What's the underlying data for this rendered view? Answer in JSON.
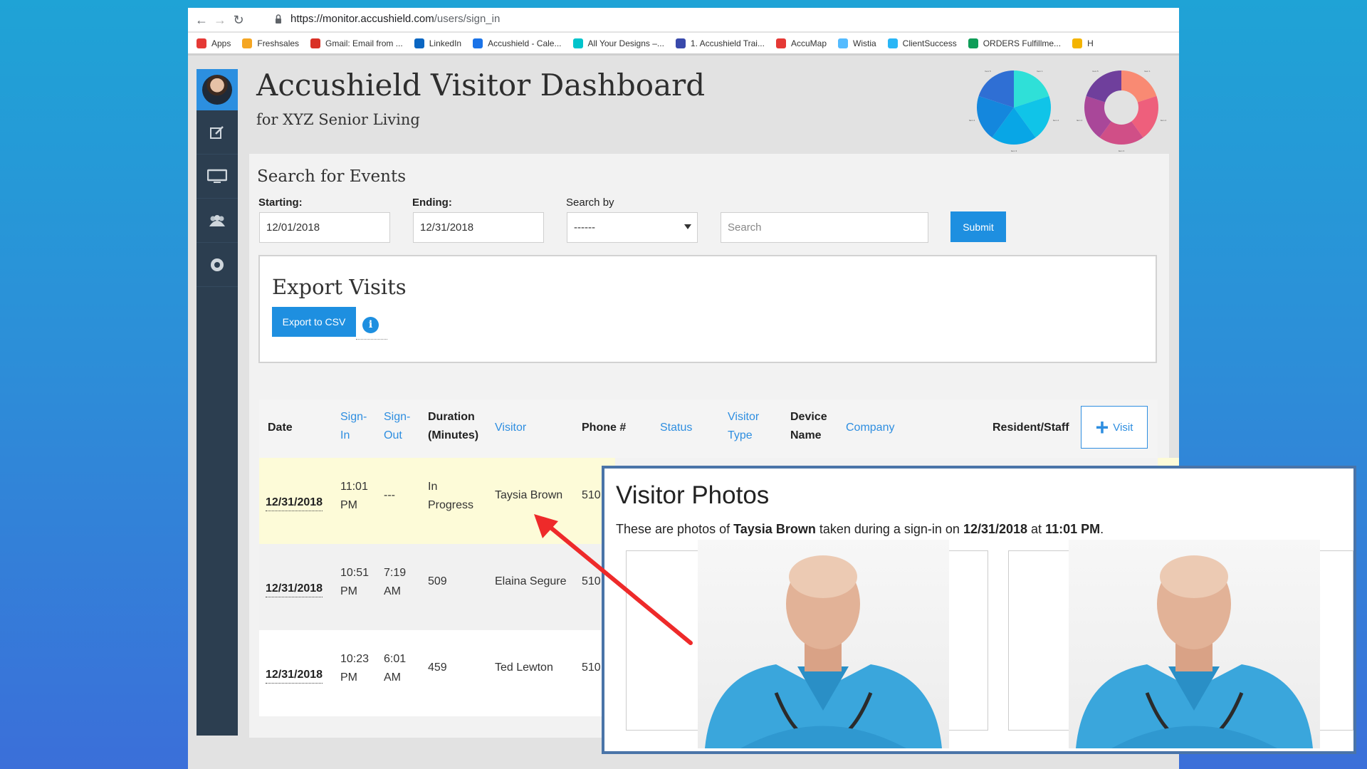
{
  "browser": {
    "url_base": "https://monitor.accushield.com",
    "url_path": "/users/sign_in",
    "bookmarks": [
      {
        "label": "Apps",
        "color": "#e53935"
      },
      {
        "label": "Freshsales",
        "color": "#f5a623"
      },
      {
        "label": "Gmail: Email from ...",
        "color": "#d93025"
      },
      {
        "label": "LinkedIn",
        "color": "#0a66c2"
      },
      {
        "label": "Accushield - Cale...",
        "color": "#1a73e8"
      },
      {
        "label": "All Your Designs –...",
        "color": "#00c4cc"
      },
      {
        "label": "1. Accushield Trai...",
        "color": "#3949ab"
      },
      {
        "label": "AccuMap",
        "color": "#e53935"
      },
      {
        "label": "Wistia",
        "color": "#54bbff"
      },
      {
        "label": "ClientSuccess",
        "color": "#29b6f6"
      },
      {
        "label": "ORDERS Fulfillme...",
        "color": "#0f9d58"
      },
      {
        "label": "H",
        "color": "#f4b400"
      }
    ]
  },
  "sidebar": {
    "items": [
      {
        "icon": "edit-icon"
      },
      {
        "icon": "monitor-icon"
      },
      {
        "icon": "users-icon"
      },
      {
        "icon": "settings-icon"
      }
    ]
  },
  "header": {
    "title": "Accushield Visitor Dashboard",
    "subtitle": "for XYZ Senior Living"
  },
  "chart_data": [
    {
      "type": "pie",
      "categories": [
        "Item 1",
        "Item 2",
        "Item 3",
        "Item 4",
        "Item 5"
      ],
      "values": [
        20,
        20,
        20,
        20,
        20
      ],
      "colors": [
        "#2fe0d8",
        "#10c4e8",
        "#08a6e6",
        "#1487dd",
        "#2f6fd4"
      ]
    },
    {
      "type": "pie",
      "categories": [
        "Item 1",
        "Item 2",
        "Item 3",
        "Item 4",
        "Item 5"
      ],
      "values": [
        20,
        20,
        20,
        20,
        20
      ],
      "colors": [
        "#f98a73",
        "#ee5f7c",
        "#d04f87",
        "#a94799",
        "#6f3f9c"
      ],
      "donut": true
    }
  ],
  "search": {
    "title": "Search for Events",
    "starting_label": "Starting:",
    "starting_value": "12/01/2018",
    "ending_label": "Ending:",
    "ending_value": "12/31/2018",
    "search_by_label": "Search by",
    "search_by_value": "------",
    "search_placeholder": "Search",
    "submit_label": "Submit"
  },
  "export": {
    "title": "Export Visits",
    "button_label": "Export to CSV",
    "info_glyph": "i"
  },
  "table": {
    "headers": {
      "date": "Date",
      "sign_in": [
        "Sign-",
        "In"
      ],
      "sign_out": [
        "Sign-",
        "Out"
      ],
      "duration": [
        "Duration",
        "(Minutes)"
      ],
      "visitor": "Visitor",
      "phone": "Phone #",
      "status": "Status",
      "visitor_type": [
        "Visitor",
        "Type"
      ],
      "device_name": [
        "Device",
        "Name"
      ],
      "company": "Company",
      "resident_staff": "Resident/Staff"
    },
    "add_visit_label": "Visit",
    "rows": [
      {
        "date": "12/31/2018",
        "sign_in": [
          "11:01",
          "PM"
        ],
        "sign_out": [
          "---",
          ""
        ],
        "duration": [
          "In",
          "Progress"
        ],
        "visitor": "Taysia Brown",
        "phone": "510"
      },
      {
        "date": "12/31/2018",
        "sign_in": [
          "10:51",
          "PM"
        ],
        "sign_out": [
          "7:19",
          "AM"
        ],
        "duration": [
          "509",
          ""
        ],
        "visitor": "Elaina Segure",
        "phone": "510"
      },
      {
        "date": "12/31/2018",
        "sign_in": [
          "10:23",
          "PM"
        ],
        "sign_out": [
          "6:01",
          "AM"
        ],
        "duration": [
          "459",
          ""
        ],
        "visitor": "Ted Lewton",
        "phone": "510"
      }
    ]
  },
  "modal": {
    "title": "Visitor Photos",
    "text_prefix": "These are photos of ",
    "visitor": "Taysia Brown",
    "text_mid": " taken during a sign-in on ",
    "date": "12/31/2018",
    "text_at": " at ",
    "time": "11:01 PM",
    "text_end": "."
  }
}
